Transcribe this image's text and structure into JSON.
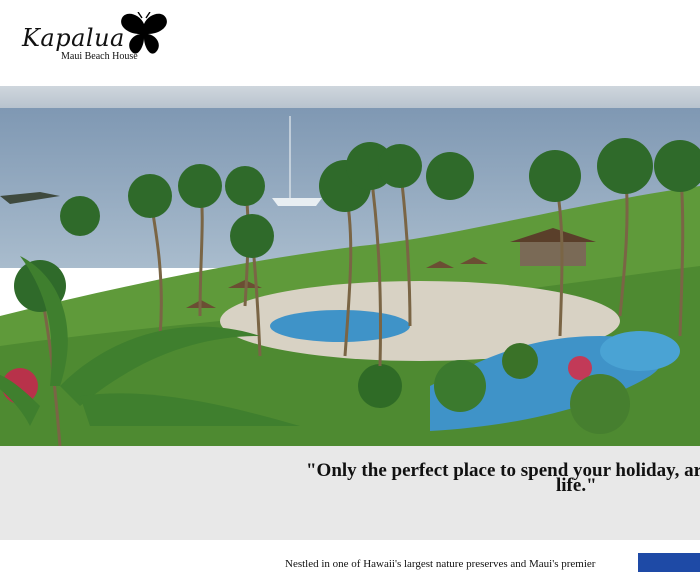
{
  "brand": {
    "name": "Kapalua",
    "tagline": "Maui Beach House",
    "logo_icon": "butterfly-icon"
  },
  "hero": {
    "image": "resort-pool-ocean-palms"
  },
  "quote": {
    "line1": "\"Only the perfect place to spend your holiday, ar",
    "line2": "life.\""
  },
  "intro": {
    "text": "Nestled in one of Hawaii's largest nature preserves and Maui's premier"
  },
  "colors": {
    "quote_band": "#e8e8e8",
    "side_box": "#1e4aa6",
    "ocean": "#8aa6c4",
    "lawn": "#5f9a3a",
    "pool": "#3f93c8"
  }
}
